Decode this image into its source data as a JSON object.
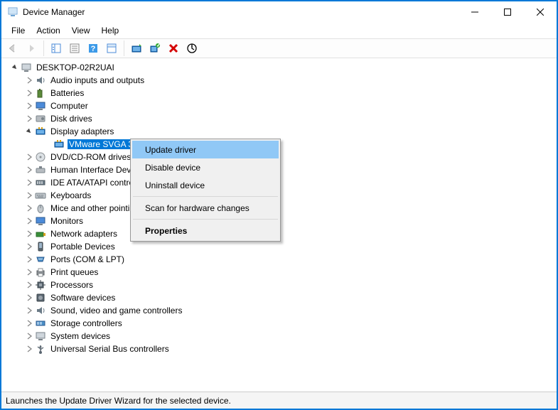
{
  "window": {
    "title": "Device Manager"
  },
  "menu": {
    "file": "File",
    "action": "Action",
    "view": "View",
    "help": "Help"
  },
  "status": "Launches the Update Driver Wizard for the selected device.",
  "tree": {
    "root": "DESKTOP-02R2UAI",
    "audio": "Audio inputs and outputs",
    "batteries": "Batteries",
    "computer": "Computer",
    "disk": "Disk drives",
    "display": "Display adapters",
    "display_child": "VMware SVGA 3D",
    "dvd": "DVD/CD-ROM drives",
    "hid": "Human Interface Devices",
    "ide": "IDE ATA/ATAPI controllers",
    "keyboards": "Keyboards",
    "mice": "Mice and other pointing devices",
    "monitors": "Monitors",
    "network": "Network adapters",
    "portable": "Portable Devices",
    "ports": "Ports (COM & LPT)",
    "printq": "Print queues",
    "processors": "Processors",
    "software": "Software devices",
    "sound": "Sound, video and game controllers",
    "storage": "Storage controllers",
    "system": "System devices",
    "usb": "Universal Serial Bus controllers"
  },
  "context": {
    "update": "Update driver",
    "disable": "Disable device",
    "uninstall": "Uninstall device",
    "scan": "Scan for hardware changes",
    "properties": "Properties"
  }
}
